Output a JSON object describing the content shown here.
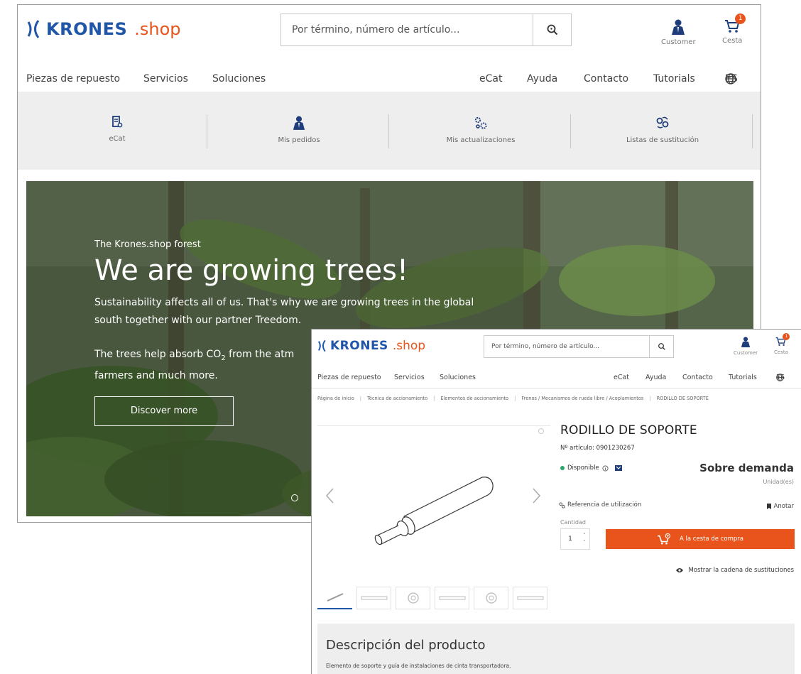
{
  "brand": {
    "name": "KRONES",
    "suffix": ".shop",
    "primary_color": "#1f56a8",
    "accent_color": "#e8541c"
  },
  "header": {
    "search_placeholder": "Por término, número de artículo...",
    "customer_label": "Customer",
    "cart_label": "Cesta",
    "cart_count": "1"
  },
  "nav": {
    "left": [
      "Piezas de repuesto",
      "Servicios",
      "Soluciones"
    ],
    "right": [
      "eCat",
      "Ayuda",
      "Contacto",
      "Tutorials"
    ],
    "language": "ES"
  },
  "quick_links": [
    {
      "label": "eCat",
      "icon": "catalog-icon"
    },
    {
      "label": "Mis pedidos",
      "icon": "person-icon"
    },
    {
      "label": "Mis actualizaciones",
      "icon": "gears-icon"
    },
    {
      "label": "Listas de sustitución",
      "icon": "swap-icon"
    }
  ],
  "hero": {
    "kicker": "The Krones.shop forest",
    "title": "We are growing trees!",
    "body1": "Sustainability affects all of us. That's why we are growing trees in the global south together with our partner Treedom.",
    "body2_pre": "The trees help absorb CO",
    "body2_sub": "2",
    "body2_post": " from the atm",
    "body2_line2": "farmers and much more.",
    "button": "Discover more"
  },
  "product_page": {
    "breadcrumbs": [
      "Página de inicio",
      "Técnica de accionamiento",
      "Elementos de accionamiento",
      "Frenos / Mecanismos de rueda libre / Acoplamientos",
      "RODILLO DE SOPORTE"
    ],
    "title": "RODILLO DE SOPORTE",
    "article_number": "Nº artículo: 0901230267",
    "availability": "Disponible",
    "price": "Sobre demanda",
    "unit": "Unidad(es)",
    "usage_reference": "Referencia de utilización",
    "note": "Anotar",
    "quantity_label": "Cantidad",
    "quantity": "1",
    "add_to_cart": "A la cesta de compra",
    "substitution_chain": "Mostrar la cadena de sustituciones",
    "description_title": "Descripción del producto",
    "description_body": "Elemento de soporte y guía de instalaciones de cinta transportadora."
  }
}
